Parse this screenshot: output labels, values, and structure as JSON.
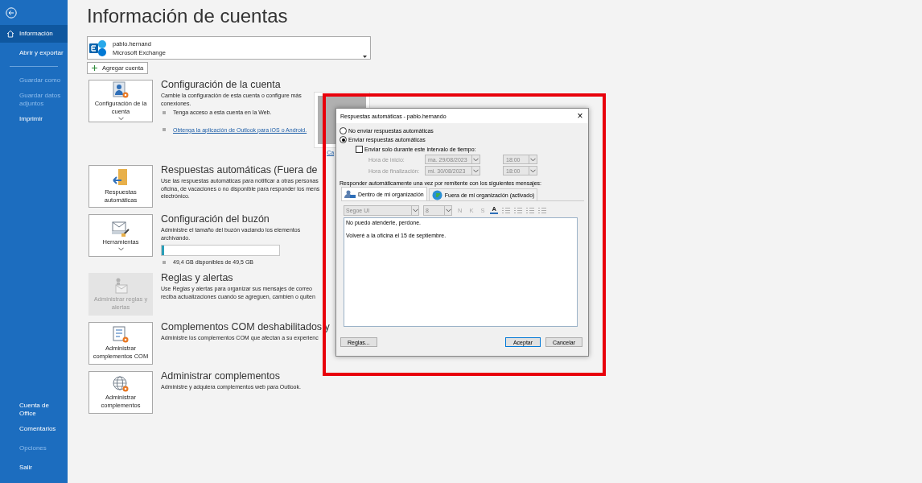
{
  "sidebar": {
    "items": [
      {
        "label": "Información",
        "kind": "home",
        "selected": true,
        "disabled": false
      },
      {
        "label": "Abrir y exportar",
        "kind": "item",
        "selected": false,
        "disabled": false
      },
      {
        "kind": "divider"
      },
      {
        "label": "Guardar como",
        "kind": "item",
        "selected": false,
        "disabled": true
      },
      {
        "label": "Guardar datos adjuntos",
        "kind": "item",
        "selected": false,
        "disabled": true
      },
      {
        "label": "Imprimir",
        "kind": "item",
        "selected": false,
        "disabled": false
      }
    ],
    "footer_items": [
      {
        "label": "Cuenta de Office",
        "selected": false,
        "disabled": false
      },
      {
        "label": "Comentarios",
        "selected": false,
        "disabled": false
      },
      {
        "label": "Opciones",
        "selected": false,
        "disabled": true
      },
      {
        "label": "Salir",
        "selected": false,
        "disabled": false
      }
    ]
  },
  "page_title": "Información de cuentas",
  "account": {
    "name": "pablo.hernand",
    "type": "Microsoft Exchange"
  },
  "add_account_button": "Agregar cuenta",
  "sections": [
    {
      "kind": "account",
      "button": "Configuración de la cuenta",
      "has_menu": true,
      "disabled": false,
      "heading": "Configuración de la cuenta",
      "description_lines": [
        "Cambie la configuración de esta cuenta o configure más",
        "conexiones."
      ],
      "bullets": [
        {
          "text": "Tenga acceso a esta cuenta en la Web.",
          "link": false
        },
        {
          "text": "Obtenga la aplicación de Outlook para iOS o Android.",
          "link": true
        }
      ],
      "photo_link": "Ca"
    },
    {
      "kind": "auto-reply",
      "button": "Respuestas automáticas",
      "has_menu": false,
      "disabled": false,
      "heading": "Respuestas automáticas (Fuera de",
      "description_lines": [
        "Use las respuestas automáticas para notificar a otras personas",
        "oficina, de vacaciones o no disponible para responder los mens",
        "electrónico."
      ]
    },
    {
      "kind": "mailbox",
      "button": "Herramientas",
      "has_menu": true,
      "disabled": false,
      "heading": "Configuración del buzón",
      "description_lines": [
        "Administre el tamaño del buzón vaciando los elementos",
        "archivando."
      ],
      "storage": {
        "level": 0.02,
        "reading": "49,4 GB disponibles de 49,5 GB"
      }
    },
    {
      "kind": "rules",
      "button": "Administrar reglas y alertas",
      "has_menu": false,
      "disabled": true,
      "heading": "Reglas y alertas",
      "description_lines": [
        "Use Reglas y alertas para organizar sus mensajes de correo",
        "reciba actualizaciones cuando se agreguen, cambien o quiten"
      ]
    },
    {
      "kind": "com",
      "button": "Administrar complementos COM",
      "has_menu": false,
      "disabled": false,
      "heading": "Complementos COM deshabilitados y",
      "description_lines": [
        "Administre los complementos COM que afectan a su experienc"
      ]
    },
    {
      "kind": "addins",
      "button": "Administrar complementos",
      "has_menu": false,
      "disabled": false,
      "heading": "Administrar complementos",
      "description_lines": [
        "Administre y adquiera complementos web para Outlook."
      ]
    }
  ],
  "dialog": {
    "title": "Respuestas automáticas - pablo.hernando",
    "close": "×",
    "radios": [
      {
        "label": "No enviar respuestas automáticas",
        "selected": false
      },
      {
        "label": "Enviar respuestas automáticas",
        "selected": true
      }
    ],
    "interval": {
      "label": "Enviar solo durante este intervalo de tiempo:",
      "checked": false
    },
    "time_rows": [
      {
        "label": "Hora de inicio:",
        "date": "ma. 29/08/2023",
        "time": "18:00",
        "disabled": true
      },
      {
        "label": "Hora de finalización:",
        "date": "mi. 30/08/2023",
        "time": "18:00",
        "disabled": true
      }
    ],
    "reply_label": "Responder automáticamente una vez por remitente con los siguientes mensajes:",
    "tabs": [
      {
        "label": "Dentro de mi organización",
        "kind": "inside",
        "selected": true
      },
      {
        "label": "Fuera de mi organización (activado)",
        "kind": "outside",
        "selected": false
      }
    ],
    "toolbar": {
      "font": "Segoe UI",
      "size": "8",
      "format_buttons": [
        {
          "label": "N",
          "kind": "bold"
        },
        {
          "label": "K",
          "kind": "italic"
        },
        {
          "label": "S",
          "kind": "underline"
        },
        {
          "label": "A",
          "kind": "color"
        }
      ]
    },
    "message_paragraphs": [
      "No puedo atenderle, perdone.",
      "Volveré a la oficina el 15 de septiembre."
    ],
    "buttons": [
      {
        "label": "Reglas...",
        "kind": "rules"
      },
      {
        "label": "Aceptar",
        "kind": "ok"
      },
      {
        "label": "Cancelar",
        "kind": "cancel"
      }
    ]
  }
}
